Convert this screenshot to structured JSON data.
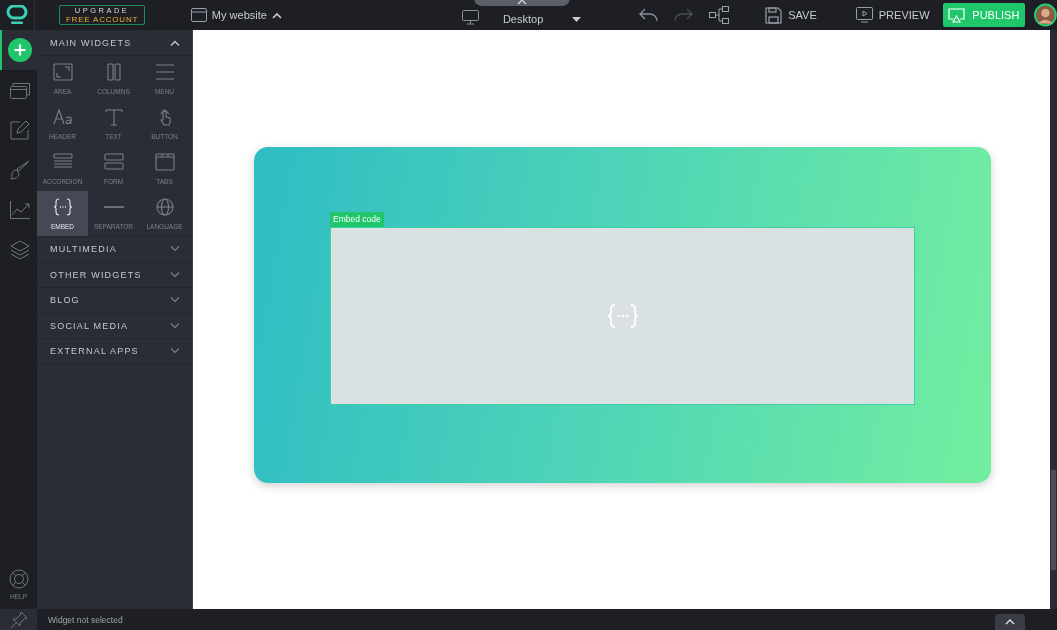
{
  "topbar": {
    "upgrade": {
      "line_1": "UPGRADE",
      "line_2": "FREE ACCOUNT"
    },
    "site": "My website",
    "device": "Desktop",
    "undo": {
      "disabled": false
    },
    "redo": {
      "disabled": true
    },
    "save": "SAVE",
    "preview": "PREVIEW",
    "publish": "PUBLISH"
  },
  "rail": {
    "items": [
      {
        "kind": "add",
        "selected": true
      },
      {
        "kind": "pages",
        "selected": false
      },
      {
        "kind": "edit",
        "selected": false
      },
      {
        "kind": "design",
        "selected": false
      },
      {
        "kind": "stats",
        "selected": false
      },
      {
        "kind": "layers",
        "selected": false
      }
    ],
    "help": "HELP"
  },
  "panel": {
    "sections": [
      {
        "title": "MAIN WIDGETS",
        "expanded": true,
        "widgets": [
          {
            "kind": "area",
            "label": "AREA",
            "selected": false
          },
          {
            "kind": "columns",
            "label": "COLUMNS",
            "selected": false
          },
          {
            "kind": "menu",
            "label": "MENU",
            "selected": false
          },
          {
            "kind": "header",
            "label": "HEADER",
            "selected": false
          },
          {
            "kind": "text",
            "label": "TEXT",
            "selected": false
          },
          {
            "kind": "button",
            "label": "BUTTON",
            "selected": false
          },
          {
            "kind": "accordion",
            "label": "ACCORDION",
            "selected": false
          },
          {
            "kind": "form",
            "label": "FORM",
            "selected": false
          },
          {
            "kind": "tabs",
            "label": "TABS",
            "selected": false
          },
          {
            "kind": "embed",
            "label": "EMBED",
            "selected": true
          },
          {
            "kind": "separator",
            "label": "SEPARATOR",
            "selected": false
          },
          {
            "kind": "language",
            "label": "LANGUAGE",
            "selected": false
          }
        ]
      },
      {
        "title": "MULTIMEDIA",
        "expanded": false
      },
      {
        "title": "OTHER WIDGETS",
        "expanded": false
      },
      {
        "title": "BLOG",
        "expanded": false
      },
      {
        "title": "SOCIAL MEDIA",
        "expanded": false
      },
      {
        "title": "EXTERNAL APPS",
        "expanded": false
      }
    ]
  },
  "canvas": {
    "embed_label": "Embed code"
  },
  "status_bar": {
    "text": "Widget not selected"
  }
}
